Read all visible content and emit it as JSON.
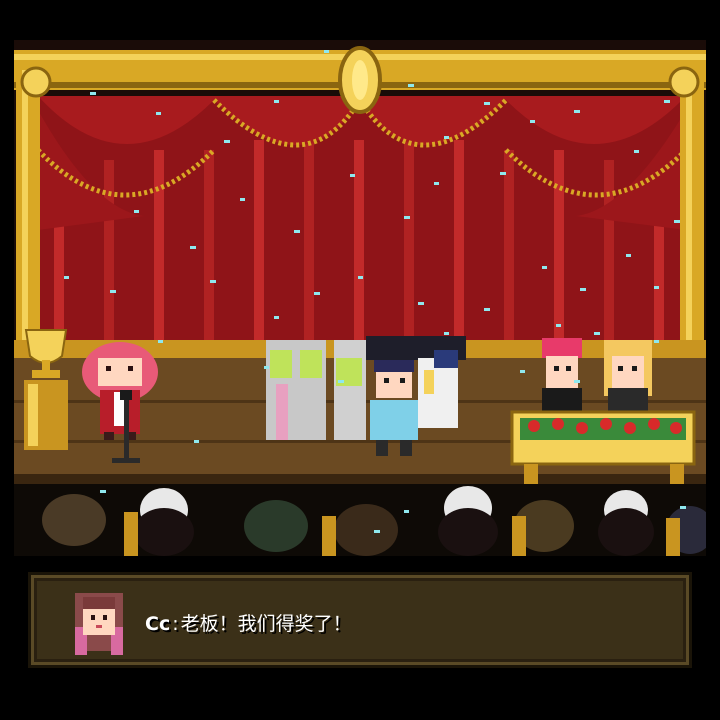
{
  "dialog": {
    "speaker": "Cc",
    "separator": ":",
    "text": "老板！我们得奖了！"
  },
  "colors": {
    "curtain": "#8f1418",
    "curtain_highlight": "#c22a2a",
    "gold_frame": "#d9a825",
    "stage_floor": "#6b4a22",
    "dialog_bg": "#3b3018",
    "confetti": "#8fe8ee"
  },
  "icons": {
    "trophy": "trophy-icon",
    "microphone": "microphone-icon",
    "flower_bouquet": "flower-table-icon"
  }
}
